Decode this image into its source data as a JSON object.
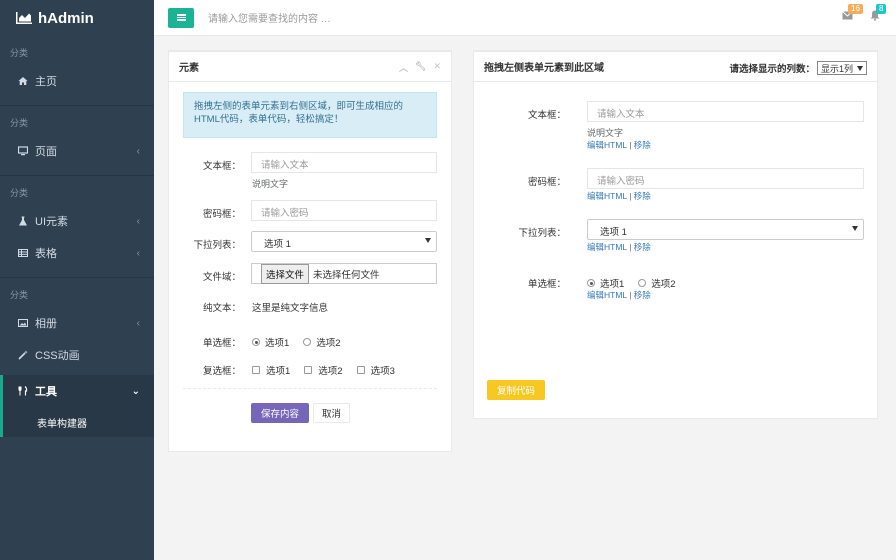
{
  "sidebar": {
    "brand": "hAdmin",
    "category1": "分类",
    "home": "主页",
    "category2": "分类",
    "pages": "页面",
    "category3": "分类",
    "ui": "UI元素",
    "table": "表格",
    "category4": "分类",
    "album": "相册",
    "css_anim": "CSS动画",
    "tools": "工具",
    "form_builder": "表单构建器"
  },
  "header": {
    "search_placeholder": "请输入您需要查找的内容 …",
    "mail_count": "16",
    "bell_count": "8"
  },
  "left_panel": {
    "title": "元素",
    "alert": "拖拽左侧的表单元素到右侧区域，即可生成相应的HTML代码，表单代码，轻松搞定！",
    "text_label": "文本框：",
    "text_placeholder": "请输入文本",
    "text_help": "说明文字",
    "password_label": "密码框：",
    "password_placeholder": "请输入密码",
    "select_label": "下拉列表：",
    "select_value": "选项 1",
    "file_label": "文件域：",
    "file_button": "选择文件",
    "file_status": "未选择任何文件",
    "static_label": "纯文本：",
    "static_text": "这里是纯文字信息",
    "radio_label": "单选框：",
    "radio_options": [
      "选项1",
      "选项2"
    ],
    "checkbox_label": "复选框：",
    "checkbox_options": [
      "选项1",
      "选项2",
      "选项3"
    ],
    "save_button": "保存内容",
    "cancel_button": "取消"
  },
  "right_panel": {
    "title": "拖拽左侧表单元素到此区域",
    "column_label": "请选择显示的列数：",
    "column_value": "显示1列",
    "text_label": "文本框：",
    "text_placeholder": "请输入文本",
    "text_help": "说明文字",
    "password_label": "密码框：",
    "password_placeholder": "请输入密码",
    "select_label": "下拉列表：",
    "select_value": "选项 1",
    "radio_label": "单选框：",
    "radio_options": [
      "选项1",
      "选项2"
    ],
    "edit_html": "编辑HTML",
    "link_sep": "|",
    "remove": "移除",
    "copy_button": "复制代码"
  },
  "colors": {
    "sidebar_bg": "#2f4050",
    "accent": "#1ab394",
    "primary_button": "#7666b8",
    "copy_button": "#f8c822"
  }
}
